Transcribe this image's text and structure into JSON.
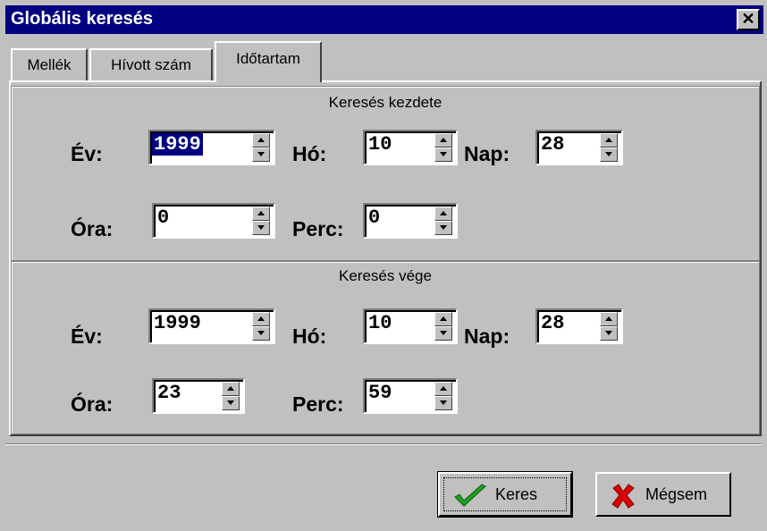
{
  "window": {
    "title": "Globális keresés",
    "close_glyph": "✕"
  },
  "tabs": [
    {
      "label": "Mellék"
    },
    {
      "label": "Hívott szám"
    },
    {
      "label": "Időtartam"
    }
  ],
  "start": {
    "title": "Keresés kezdete",
    "ev_label": "Év:",
    "ev": "1999",
    "ho_label": "Hó:",
    "ho": "10",
    "nap_label": "Nap:",
    "nap": "28",
    "ora_label": "Óra:",
    "ora": "0",
    "perc_label": "Perc:",
    "perc": "0"
  },
  "end": {
    "title": "Keresés vége",
    "ev_label": "Év:",
    "ev": "1999",
    "ho_label": "Hó:",
    "ho": "10",
    "nap_label": "Nap:",
    "nap": "28",
    "ora_label": "Óra:",
    "ora": "23",
    "perc_label": "Perc:",
    "perc": "59"
  },
  "buttons": {
    "search_label": "Keres",
    "search_icon": "checkmark-icon",
    "cancel_label": "Mégsem",
    "cancel_icon": "red-x-icon"
  },
  "colors": {
    "title_bg": "#000080",
    "face": "#c0c0c0",
    "check": "#20a020",
    "cancel_x": "#e00000"
  }
}
